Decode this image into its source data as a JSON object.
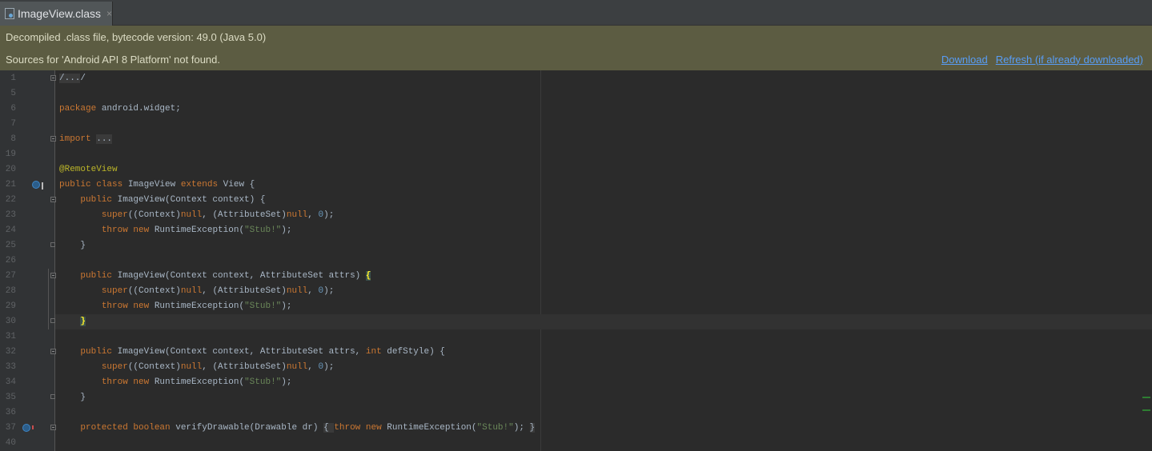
{
  "tab": {
    "title": "ImageView.class",
    "close": "×"
  },
  "banner": {
    "line1": "Decompiled .class file, bytecode version: 49.0 (Java 5.0)",
    "line2": "Sources for 'Android API 8 Platform' not found.",
    "download": "Download",
    "refresh": "Refresh (if already downloaded)"
  },
  "colors": {
    "keyword": "#cc7832",
    "string": "#6a8759",
    "number": "#6897bb",
    "annotation": "#bbb529",
    "banner": "#5c5c42",
    "link": "#589df6"
  },
  "lines": [
    {
      "n": "1",
      "fold": "closed",
      "segs": [
        {
          "t": "/...",
          "c": "fold-ph"
        },
        {
          "t": "/"
        }
      ]
    },
    {
      "n": "5",
      "segs": []
    },
    {
      "n": "6",
      "segs": [
        {
          "t": "package",
          "c": "kw"
        },
        {
          "t": " android.widget;"
        }
      ]
    },
    {
      "n": "7",
      "segs": []
    },
    {
      "n": "8",
      "fold": "closed",
      "segs": [
        {
          "t": "import",
          "c": "kw"
        },
        {
          "t": " "
        },
        {
          "t": "...",
          "c": "fold-ph"
        }
      ]
    },
    {
      "n": "19",
      "segs": []
    },
    {
      "n": "20",
      "segs": [
        {
          "t": "@RemoteView",
          "c": "ann"
        }
      ]
    },
    {
      "n": "21",
      "icon": "implements",
      "segs": [
        {
          "t": "public class",
          "c": "kw"
        },
        {
          "t": " ImageView "
        },
        {
          "t": "extends",
          "c": "kw"
        },
        {
          "t": " View {"
        }
      ]
    },
    {
      "n": "22",
      "fold": "open",
      "segs": [
        {
          "t": "    "
        },
        {
          "t": "public",
          "c": "kw"
        },
        {
          "t": " ImageView(Context context) {"
        }
      ]
    },
    {
      "n": "23",
      "segs": [
        {
          "t": "        "
        },
        {
          "t": "super",
          "c": "kw"
        },
        {
          "t": "((Context)"
        },
        {
          "t": "null",
          "c": "kw"
        },
        {
          "t": ", (AttributeSet)"
        },
        {
          "t": "null",
          "c": "kw"
        },
        {
          "t": ", "
        },
        {
          "t": "0",
          "c": "num"
        },
        {
          "t": ");"
        }
      ]
    },
    {
      "n": "24",
      "segs": [
        {
          "t": "        "
        },
        {
          "t": "throw new",
          "c": "kw"
        },
        {
          "t": " RuntimeException("
        },
        {
          "t": "\"Stub!\"",
          "c": "str"
        },
        {
          "t": ");"
        }
      ]
    },
    {
      "n": "25",
      "fold": "end",
      "segs": [
        {
          "t": "    }"
        }
      ]
    },
    {
      "n": "26",
      "segs": []
    },
    {
      "n": "27",
      "fold": "open",
      "segs": [
        {
          "t": "    "
        },
        {
          "t": "public",
          "c": "kw"
        },
        {
          "t": " ImageView(Context context, AttributeSet attrs) "
        },
        {
          "t": "{",
          "c": "brace-hl"
        }
      ]
    },
    {
      "n": "28",
      "segs": [
        {
          "t": "        "
        },
        {
          "t": "super",
          "c": "kw"
        },
        {
          "t": "((Context)"
        },
        {
          "t": "null",
          "c": "kw"
        },
        {
          "t": ", (AttributeSet)"
        },
        {
          "t": "null",
          "c": "kw"
        },
        {
          "t": ", "
        },
        {
          "t": "0",
          "c": "num"
        },
        {
          "t": ");"
        }
      ]
    },
    {
      "n": "29",
      "segs": [
        {
          "t": "        "
        },
        {
          "t": "throw new",
          "c": "kw"
        },
        {
          "t": " RuntimeException("
        },
        {
          "t": "\"Stub!\"",
          "c": "str"
        },
        {
          "t": ");"
        }
      ]
    },
    {
      "n": "30",
      "fold": "end",
      "caret": true,
      "segs": [
        {
          "t": "    "
        },
        {
          "t": "}",
          "c": "brace-hl"
        }
      ]
    },
    {
      "n": "31",
      "segs": []
    },
    {
      "n": "32",
      "fold": "open",
      "segs": [
        {
          "t": "    "
        },
        {
          "t": "public",
          "c": "kw"
        },
        {
          "t": " ImageView(Context context, AttributeSet attrs, "
        },
        {
          "t": "int",
          "c": "kw"
        },
        {
          "t": " defStyle) {"
        }
      ]
    },
    {
      "n": "33",
      "segs": [
        {
          "t": "        "
        },
        {
          "t": "super",
          "c": "kw"
        },
        {
          "t": "((Context)"
        },
        {
          "t": "null",
          "c": "kw"
        },
        {
          "t": ", (AttributeSet)"
        },
        {
          "t": "null",
          "c": "kw"
        },
        {
          "t": ", "
        },
        {
          "t": "0",
          "c": "num"
        },
        {
          "t": ");"
        }
      ]
    },
    {
      "n": "34",
      "segs": [
        {
          "t": "        "
        },
        {
          "t": "throw new",
          "c": "kw"
        },
        {
          "t": " RuntimeException("
        },
        {
          "t": "\"Stub!\"",
          "c": "str"
        },
        {
          "t": ");"
        }
      ]
    },
    {
      "n": "35",
      "fold": "end",
      "segs": [
        {
          "t": "    }"
        }
      ]
    },
    {
      "n": "36",
      "segs": []
    },
    {
      "n": "37",
      "fold": "closed",
      "icon": "overrides",
      "segs": [
        {
          "t": "    "
        },
        {
          "t": "protected boolean",
          "c": "kw"
        },
        {
          "t": " verifyDrawable(Drawable dr) "
        },
        {
          "t": "{ ",
          "c": "fold-ph"
        },
        {
          "t": "throw new",
          "c": "kw"
        },
        {
          "t": " RuntimeException("
        },
        {
          "t": "\"Stub!\"",
          "c": "str"
        },
        {
          "t": "); "
        },
        {
          "t": "}",
          "c": "fold-ph"
        }
      ]
    },
    {
      "n": "40",
      "segs": []
    }
  ]
}
